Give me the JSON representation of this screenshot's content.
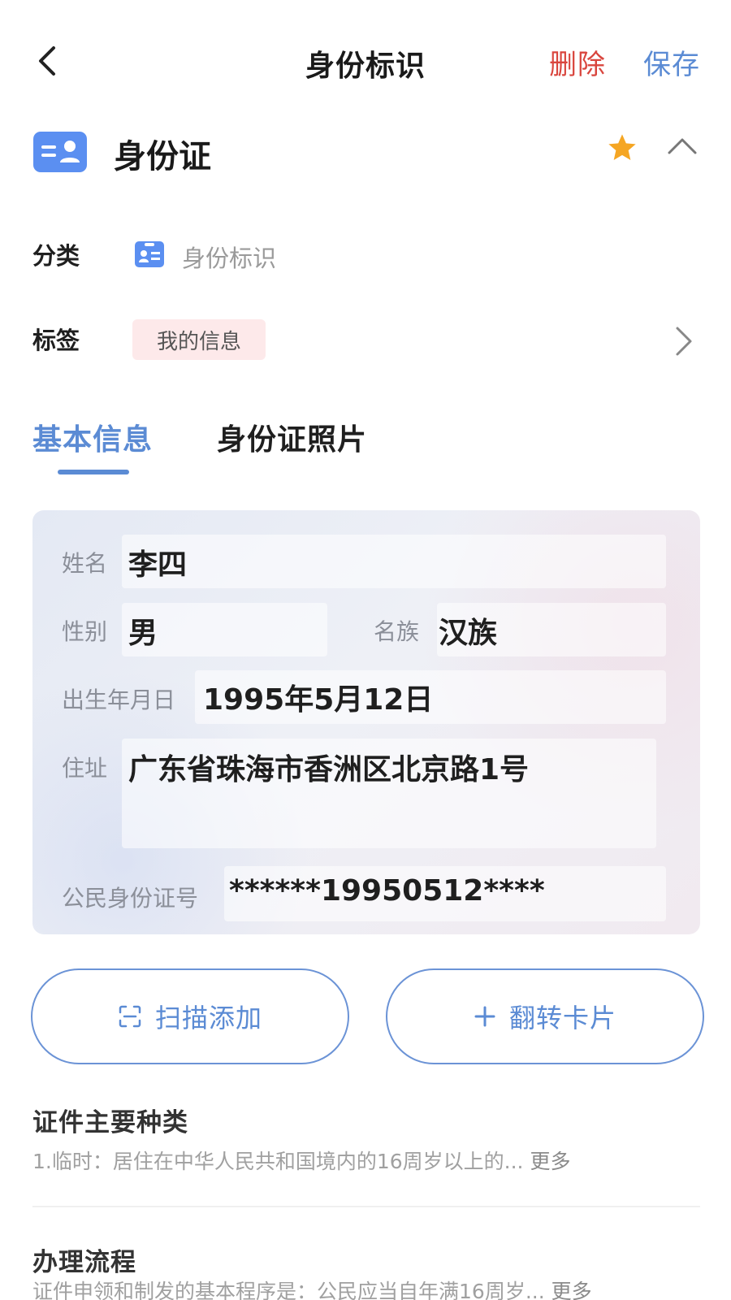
{
  "header": {
    "title": "身份标识",
    "delete_label": "删除",
    "save_label": "保存",
    "back_icon": "chevron-left-icon"
  },
  "document": {
    "name": "身份证",
    "icon": "id-card-icon",
    "favorited": true,
    "star_color": "#f5a623"
  },
  "category": {
    "label": "分类",
    "value": "身份标识"
  },
  "tags": {
    "label": "标签",
    "chip": "我的信息"
  },
  "tabs": [
    {
      "label": "基本信息",
      "active": true
    },
    {
      "label": "身份证照片",
      "active": false
    }
  ],
  "id_card": {
    "name_label": "姓名",
    "name_value": "李四",
    "gender_label": "性别",
    "gender_value": "男",
    "ethnicity_label": "名族",
    "ethnicity_value": "汉族",
    "birth_label": "出生年月日",
    "birth_value": "1995年5月12日",
    "address_label": "住址",
    "address_value": "广东省珠海市香洲区北京路1号",
    "id_label": "公民身份证号",
    "id_value": "******19950512****"
  },
  "actions": {
    "scan_label": "扫描添加",
    "flip_label": "翻转卡片"
  },
  "sections": [
    {
      "title": "证件主要种类",
      "desc": "1.临时：居住在中华人民共和国境内的16周岁以上的...",
      "more": "更多"
    },
    {
      "title": "办理流程",
      "desc": "证件申领和制发的基本程序是：公民应当自年满16周岁...",
      "more": "更多"
    }
  ],
  "colors": {
    "accent": "#5b8bd4",
    "danger": "#d9463e",
    "tag_bg": "#fde9ea"
  }
}
